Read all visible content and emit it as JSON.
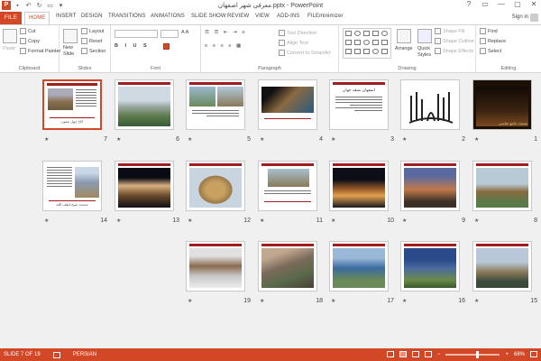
{
  "window": {
    "title": "معرفی شهر اصفهان.pptx - PowerPoint",
    "app_icon": "P",
    "qat": [
      "save-icon",
      "undo-icon",
      "redo-icon",
      "start-from-beginning-icon",
      "customize-icon"
    ],
    "controls": [
      "?",
      "▭",
      "—",
      "▢",
      "✕"
    ]
  },
  "tabs": [
    {
      "label": "FILE"
    },
    {
      "label": "HOME"
    },
    {
      "label": "INSERT"
    },
    {
      "label": "DESIGN"
    },
    {
      "label": "TRANSITIONS"
    },
    {
      "label": "ANIMATIONS"
    },
    {
      "label": "SLIDE SHOW"
    },
    {
      "label": "REVIEW"
    },
    {
      "label": "VIEW"
    },
    {
      "label": "ADD-INS"
    },
    {
      "label": "FILEminimizer"
    }
  ],
  "signin": "Sign in",
  "ribbon": {
    "clipboard": {
      "label": "Clipboard",
      "paste": "Paste",
      "cut": "Cut",
      "copy": "Copy",
      "format_painter": "Format Painter"
    },
    "slides": {
      "label": "Slides",
      "new_slide": "New",
      "new_slide2": "Slide",
      "layout": "Layout",
      "reset": "Reset",
      "section": "Section"
    },
    "font": {
      "label": "Font"
    },
    "paragraph": {
      "label": "Paragraph",
      "text_direction": "Text Direction",
      "align_text": "Align Text",
      "convert_smartart": "Convert to SmartArt"
    },
    "drawing": {
      "label": "Drawing",
      "arrange": "Arrange",
      "quick_styles": "Quick",
      "quick_styles2": "Styles",
      "shape_fill": "Shape Fill",
      "shape_outline": "Shape Outline",
      "shape_effects": "Shape Effects"
    },
    "editing": {
      "label": "Editing",
      "find": "Find",
      "replace": "Replace",
      "select": "Select"
    }
  },
  "slides": [
    {
      "number": "1",
      "kind": "night-photo",
      "caption_text": "مسجد جامع عباسی"
    },
    {
      "number": "2",
      "kind": "calligraphy"
    },
    {
      "number": "3",
      "kind": "text",
      "heading": "اصفهان نصف جهان"
    },
    {
      "number": "4",
      "kind": "photo-text"
    },
    {
      "number": "5",
      "kind": "photo-text"
    },
    {
      "number": "6",
      "kind": "photo"
    },
    {
      "number": "7",
      "kind": "text-photo",
      "selected": true,
      "caption_text": "کاخ چهل ستون"
    },
    {
      "number": "8",
      "kind": "photo"
    },
    {
      "number": "9",
      "kind": "photo"
    },
    {
      "number": "10",
      "kind": "night-photo"
    },
    {
      "number": "11",
      "kind": "photo-text"
    },
    {
      "number": "12",
      "kind": "photo"
    },
    {
      "number": "13",
      "kind": "photo"
    },
    {
      "number": "14",
      "kind": "text-photo",
      "caption_text": "مسجد شیخ لطف الله"
    },
    {
      "number": "15",
      "kind": "photo"
    },
    {
      "number": "16",
      "kind": "photo"
    },
    {
      "number": "17",
      "kind": "photo"
    },
    {
      "number": "18",
      "kind": "photo"
    },
    {
      "number": "19",
      "kind": "photo"
    }
  ],
  "status": {
    "slide_info": "SLIDE 7 OF 19",
    "language": "PERSIAN",
    "zoom": "68%",
    "colors": {
      "accent": "#d24726"
    }
  }
}
